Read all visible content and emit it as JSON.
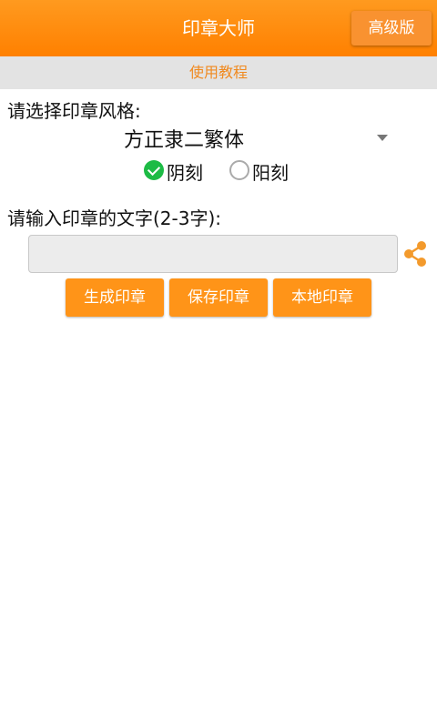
{
  "appbar": {
    "title": "印章大师",
    "pro_label": "高级版"
  },
  "tutorial": {
    "label": "使用教程"
  },
  "style_section": {
    "label": "请选择印章风格:",
    "selected_font": "方正隶二繁体",
    "dropdown_icon": "chevron-down-icon"
  },
  "engraving": {
    "options": [
      {
        "label": "阴刻",
        "checked": true
      },
      {
        "label": "阳刻",
        "checked": false
      }
    ]
  },
  "text_section": {
    "label": "请输入印章的文字(2-3字):",
    "input_value": "",
    "input_placeholder": "",
    "share_icon": "share-icon"
  },
  "actions": {
    "generate_label": "生成印章",
    "save_label": "保存印章",
    "local_label": "本地印章"
  },
  "colors": {
    "primary": "#ff8a00",
    "tutorial_text": "#f08a20",
    "radio_checked": "#1dbb45"
  }
}
